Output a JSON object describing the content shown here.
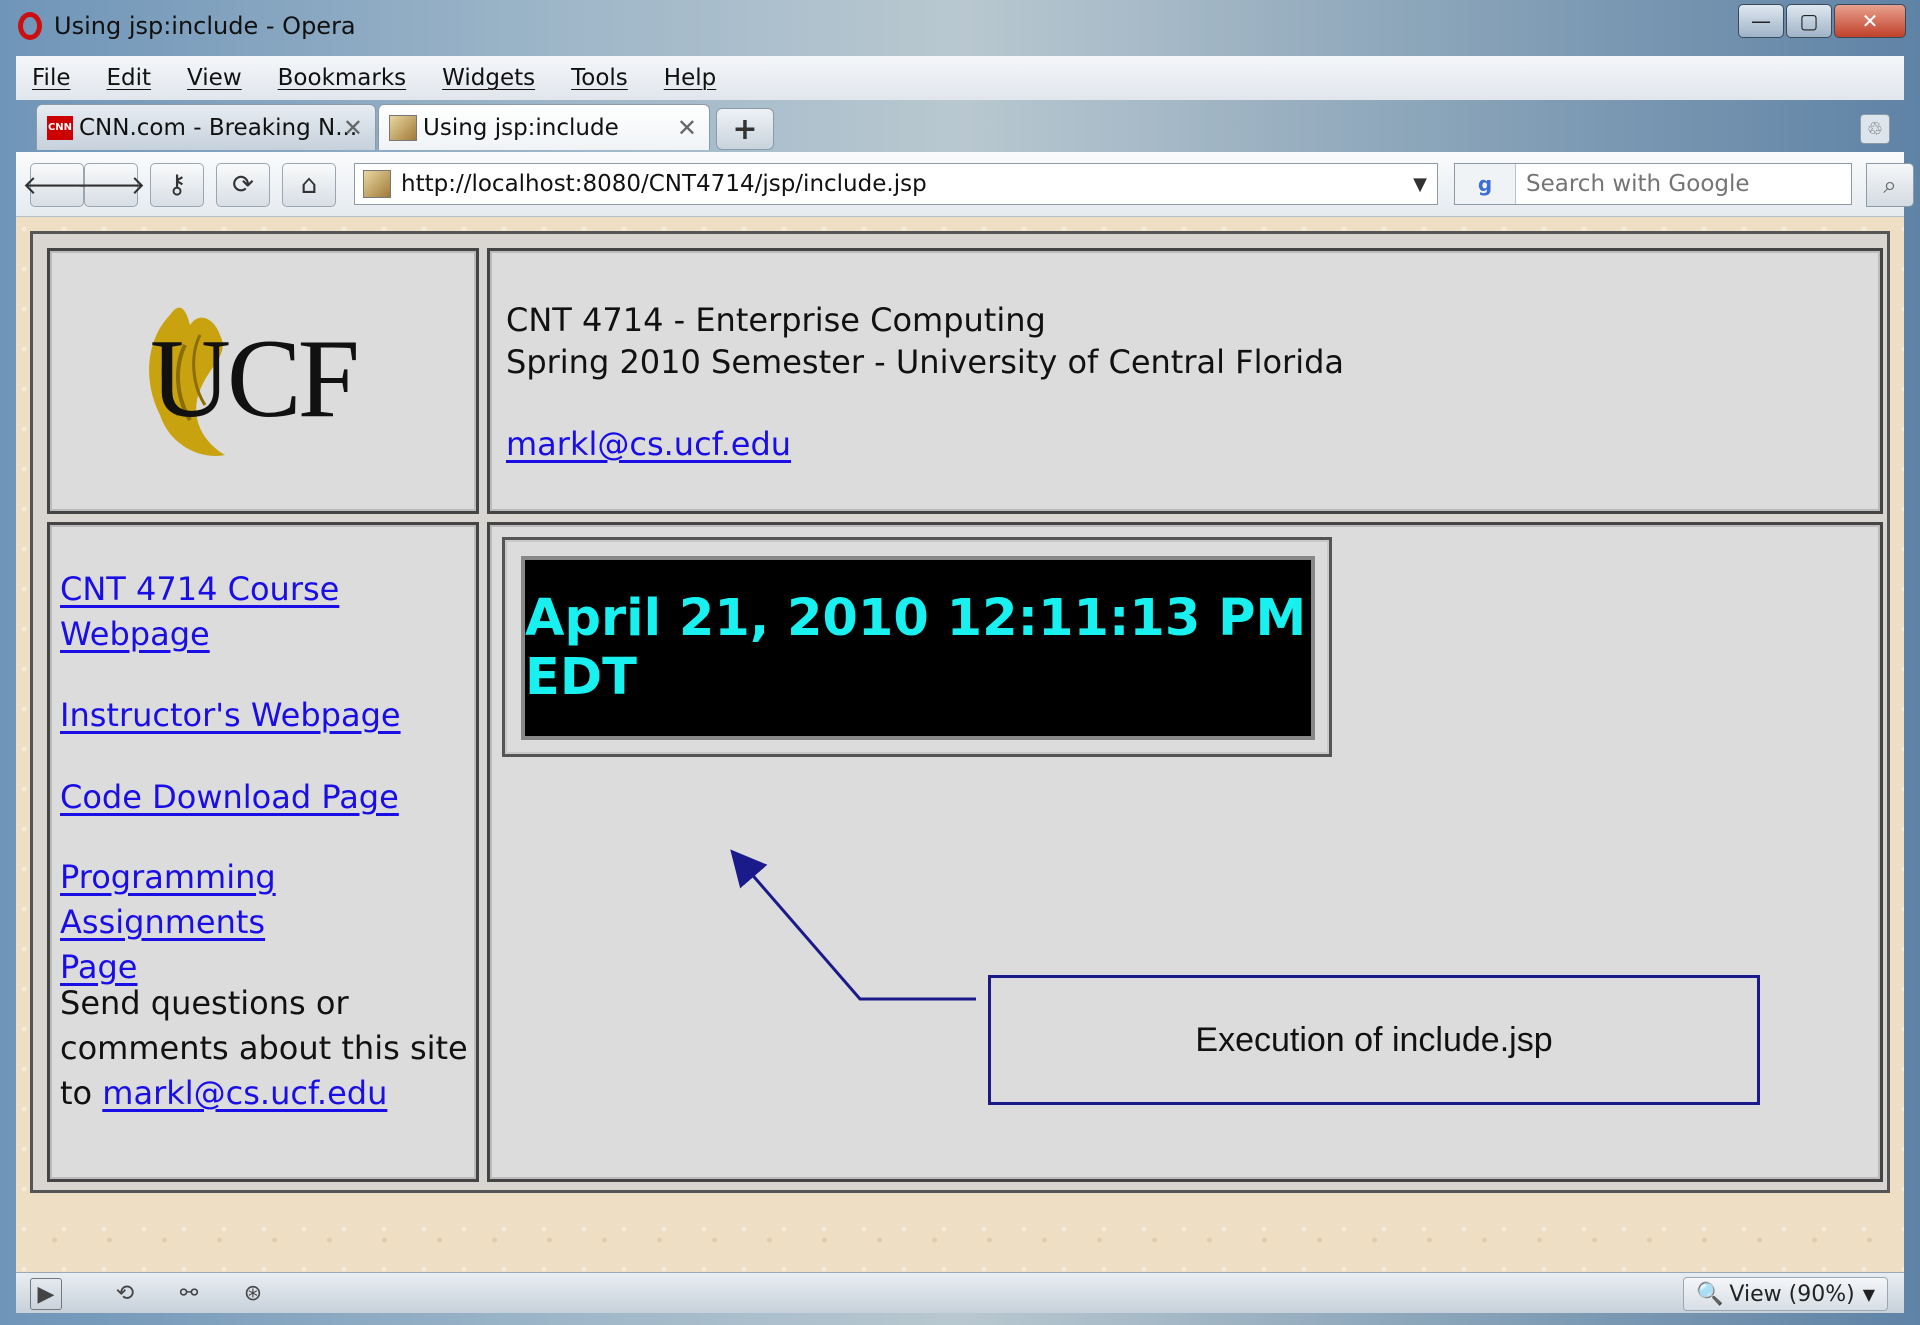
{
  "window": {
    "title": "Using jsp:include - Opera",
    "controls": {
      "minimize": "—",
      "maximize": "▢",
      "close": "✕"
    }
  },
  "menubar": {
    "items": [
      {
        "label": "File"
      },
      {
        "label": "Edit"
      },
      {
        "label": "View"
      },
      {
        "label": "Bookmarks"
      },
      {
        "label": "Widgets"
      },
      {
        "label": "Tools"
      },
      {
        "label": "Help"
      }
    ]
  },
  "tabs": [
    {
      "label": "CNN.com - Breaking N...",
      "favicon": "CNN",
      "close": "✕"
    },
    {
      "label": "Using jsp:include",
      "favicon": "page",
      "close": "✕",
      "active": true
    }
  ],
  "toolbar": {
    "new_tab": "+",
    "back": "🡐",
    "forward": "🡒",
    "key": "⚷",
    "reload": "⟳",
    "home": "⌂",
    "address": "http://localhost:8080/CNT4714/jsp/include.jsp",
    "address_dropdown": "▼",
    "search_engine": "g",
    "search_placeholder": "Search with Google",
    "search_button": "⌕"
  },
  "page": {
    "logo_text": "UCF",
    "header": {
      "line1": "CNT 4714 - Enterprise Computing",
      "line2": "Spring 2010 Semester - University of Central Florida",
      "email": "markl@cs.ucf.edu"
    },
    "nav": {
      "course_link_line1": "CNT 4714 Course",
      "course_link_line2": "Webpage",
      "instructor_link": "Instructor's Webpage",
      "code_link": "Code Download Page",
      "assignments_link_line1": "Programming Assignments",
      "assignments_link_line2": "Page",
      "send_line1": "Send questions or",
      "send_line2": "comments about this site",
      "send_prefix": "to ",
      "send_email": "markl@cs.ucf.edu"
    },
    "clock": "April 21, 2010 12:11:13 PM EDT",
    "callout": "Execution of include.jsp"
  },
  "statusbar": {
    "zoom": "View (90%)"
  },
  "colors": {
    "link": "#1a0ee6",
    "clock_text": "#19f1f1",
    "clock_bg": "#000000",
    "callout_border": "#1a1a8a",
    "logo_gold": "#c9a20f"
  }
}
